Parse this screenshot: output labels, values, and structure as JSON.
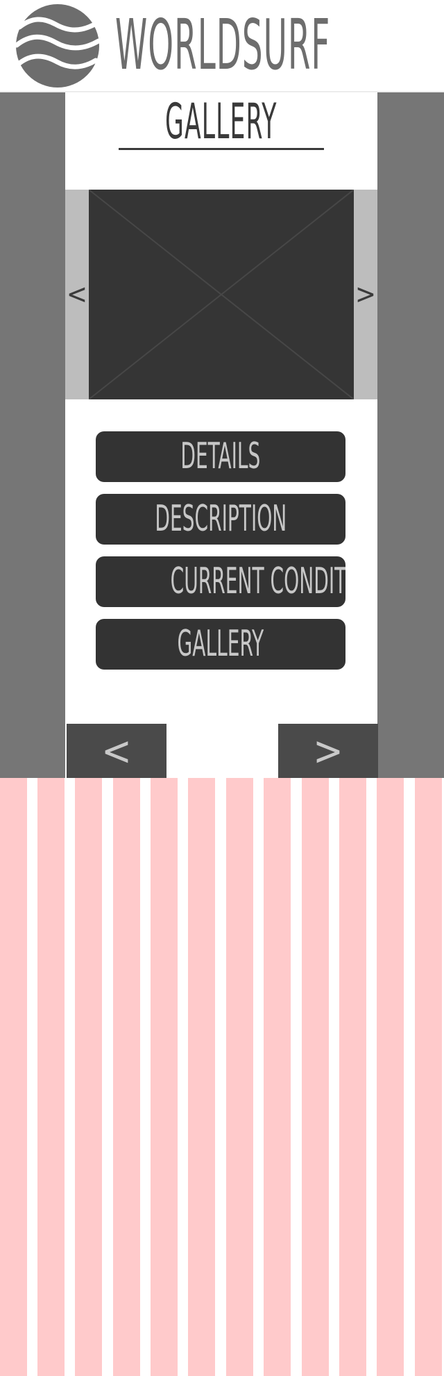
{
  "header": {
    "brand": "WORLDSURF",
    "logo_icon": "wave-logo-icon"
  },
  "main": {
    "title": "GALLERY",
    "carousel": {
      "prev_glyph": "<",
      "next_glyph": ">",
      "image_placeholder": "image-placeholder-icon"
    },
    "menu": [
      {
        "label": "DETAILS"
      },
      {
        "label": "DESCRIPTION"
      },
      {
        "label": "CURRENT CONDITIONS"
      },
      {
        "label": "GALLERY"
      }
    ],
    "pager": {
      "prev_glyph": "<",
      "next_glyph": ">"
    }
  },
  "colors": {
    "gutter": "#767676",
    "button": "#333333",
    "button_text": "#c7c7c7",
    "grid_column": "#ffcacb",
    "pager": "#4a4a4a"
  }
}
